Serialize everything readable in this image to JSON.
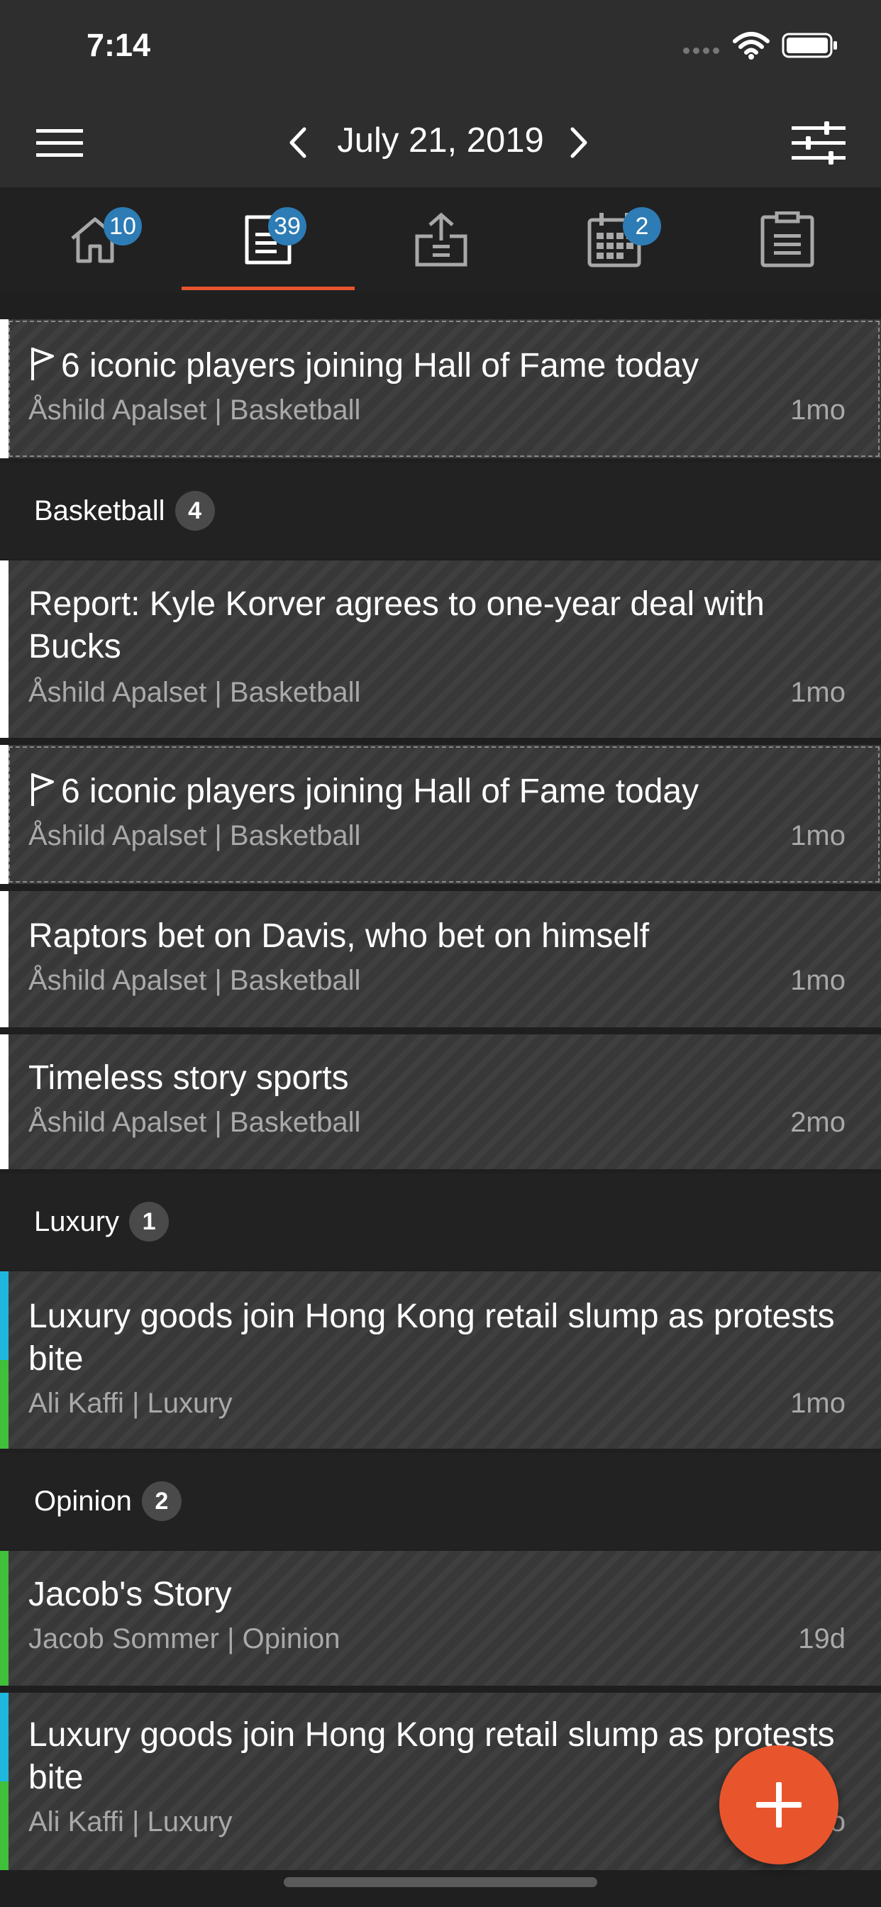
{
  "status_bar": {
    "time": "7:14"
  },
  "nav": {
    "date": "July 21, 2019"
  },
  "tabs": [
    {
      "name": "home",
      "badge": "10"
    },
    {
      "name": "stories",
      "badge": "39"
    },
    {
      "name": "publish",
      "badge": ""
    },
    {
      "name": "calendar",
      "badge": "2"
    },
    {
      "name": "notes",
      "badge": ""
    }
  ],
  "pinned": {
    "title": "6 iconic players joining Hall of Fame today",
    "meta": "Åshild Apalset | Basketball",
    "age": "1mo"
  },
  "sections": [
    {
      "name": "Basketball",
      "count": "4"
    },
    {
      "name": "Luxury",
      "count": "1"
    },
    {
      "name": "Opinion",
      "count": "2"
    }
  ],
  "stories": [
    {
      "title": "Report: Kyle Korver agrees to one-year deal with Bucks",
      "meta": "Åshild Apalset | Basketball",
      "age": "1mo"
    },
    {
      "title": "6 iconic players joining Hall of Fame today",
      "meta": "Åshild Apalset | Basketball",
      "age": "1mo"
    },
    {
      "title": "Raptors bet on Davis, who bet on himself",
      "meta": "Åshild Apalset | Basketball",
      "age": "1mo"
    },
    {
      "title": "Timeless story sports",
      "meta": "Åshild Apalset | Basketball",
      "age": "2mo"
    },
    {
      "title": "Luxury goods join Hong Kong retail slump as protests bite",
      "meta": "Ali Kaffi | Luxury",
      "age": "1mo"
    },
    {
      "title": "Jacob's Story",
      "meta": "Jacob Sommer | Opinion",
      "age": "19d"
    },
    {
      "title": "Luxury goods join Hong Kong retail slump as protests bite",
      "meta": "Ali Kaffi | Luxury",
      "age": "1mo"
    }
  ],
  "colors": {
    "accent_orange": "#e8542d",
    "badge_blue": "#2d7cb5",
    "luxury_cyan": "#1fb6de",
    "opinion_green": "#3fbf3a"
  }
}
